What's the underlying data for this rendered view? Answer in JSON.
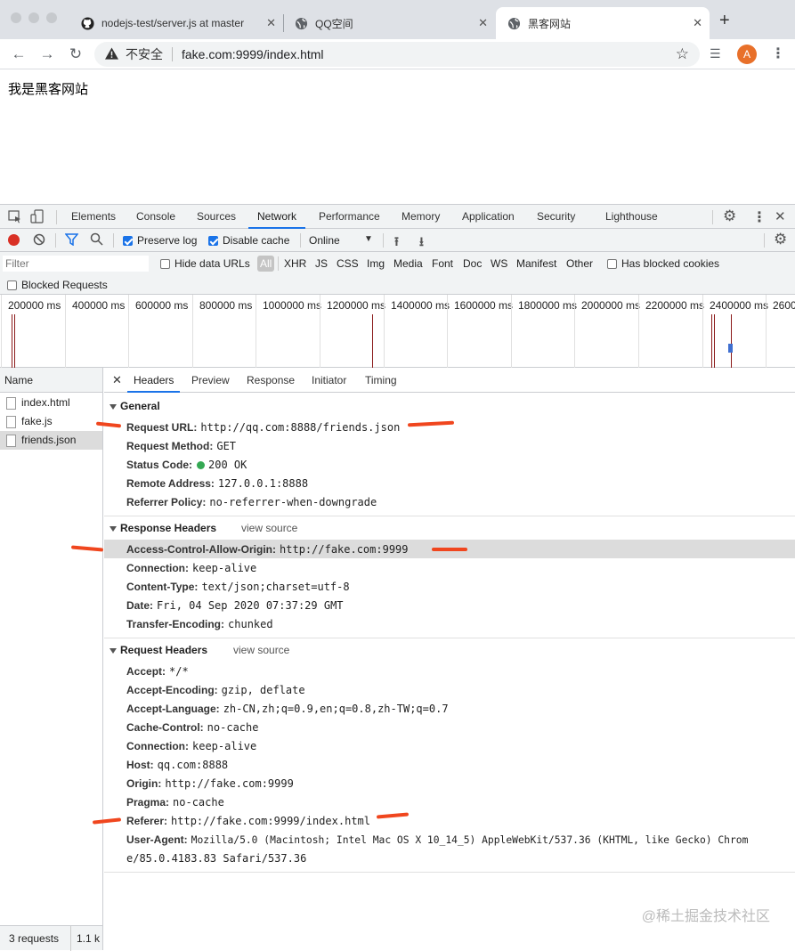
{
  "browser": {
    "tabs": [
      {
        "title": "nodejs-test/server.js at master",
        "icon": "github-icon"
      },
      {
        "title": "QQ空间",
        "icon": "globe-icon"
      },
      {
        "title": "黑客网站",
        "icon": "globe-icon"
      }
    ],
    "new_tab": "+",
    "security_label": "不安全",
    "url": "fake.com:9999/index.html",
    "avatar": "A"
  },
  "page": {
    "heading": "我是黑客网站"
  },
  "devtools": {
    "tabs": [
      "Elements",
      "Console",
      "Sources",
      "Network",
      "Performance",
      "Memory",
      "Application",
      "Security",
      "Lighthouse"
    ],
    "active_tab": "Network",
    "toolbar": {
      "preserve_log": "Preserve log",
      "disable_cache": "Disable cache",
      "throttle": "Online"
    },
    "filter": {
      "placeholder": "Filter",
      "hide_data_urls": "Hide data URLs",
      "types": [
        "All",
        "XHR",
        "JS",
        "CSS",
        "Img",
        "Media",
        "Font",
        "Doc",
        "WS",
        "Manifest",
        "Other"
      ],
      "has_blocked_cookies": "Has blocked cookies",
      "blocked_requests": "Blocked Requests"
    },
    "timeline_ticks": [
      "200000 ms",
      "400000 ms",
      "600000 ms",
      "800000 ms",
      "1000000 ms",
      "1200000 ms",
      "1400000 ms",
      "1600000 ms",
      "1800000 ms",
      "2000000 ms",
      "2200000 ms",
      "2400000 ms",
      "2600"
    ],
    "requests": {
      "header": "Name",
      "items": [
        "index.html",
        "fake.js",
        "friends.json"
      ],
      "footer_count": "3 requests",
      "footer_size": "1.1 k"
    },
    "detail_tabs": [
      "Headers",
      "Preview",
      "Response",
      "Initiator",
      "Timing"
    ],
    "general": {
      "title": "General",
      "rows": [
        {
          "k": "Request URL:",
          "v": "http://qq.com:8888/friends.json"
        },
        {
          "k": "Request Method:",
          "v": "GET"
        },
        {
          "k": "Status Code:",
          "v": "200 OK"
        },
        {
          "k": "Remote Address:",
          "v": "127.0.0.1:8888"
        },
        {
          "k": "Referrer Policy:",
          "v": "no-referrer-when-downgrade"
        }
      ]
    },
    "response_headers": {
      "title": "Response Headers",
      "view_source": "view source",
      "rows": [
        {
          "k": "Access-Control-Allow-Origin:",
          "v": "http://fake.com:9999"
        },
        {
          "k": "Connection:",
          "v": "keep-alive"
        },
        {
          "k": "Content-Type:",
          "v": "text/json;charset=utf-8"
        },
        {
          "k": "Date:",
          "v": "Fri, 04 Sep 2020 07:37:29 GMT"
        },
        {
          "k": "Transfer-Encoding:",
          "v": "chunked"
        }
      ]
    },
    "request_headers": {
      "title": "Request Headers",
      "view_source": "view source",
      "rows": [
        {
          "k": "Accept:",
          "v": "*/*"
        },
        {
          "k": "Accept-Encoding:",
          "v": "gzip, deflate"
        },
        {
          "k": "Accept-Language:",
          "v": "zh-CN,zh;q=0.9,en;q=0.8,zh-TW;q=0.7"
        },
        {
          "k": "Cache-Control:",
          "v": "no-cache"
        },
        {
          "k": "Connection:",
          "v": "keep-alive"
        },
        {
          "k": "Host:",
          "v": "qq.com:8888"
        },
        {
          "k": "Origin:",
          "v": "http://fake.com:9999"
        },
        {
          "k": "Pragma:",
          "v": "no-cache"
        },
        {
          "k": "Referer:",
          "v": "http://fake.com:9999/index.html"
        },
        {
          "k": "User-Agent:",
          "v": "Mozilla/5.0 (Macintosh; Intel Mac OS X 10_14_5) AppleWebKit/537.36 (KHTML, like Gecko) Chrom"
        }
      ],
      "ua_cont": "e/85.0.4183.83 Safari/537.36"
    },
    "colors": {
      "accent": "#1a73e8",
      "record": "#d93025",
      "annotation": "#f0461e",
      "status_ok": "#34a853"
    }
  },
  "watermark": "@稀土掘金技术社区"
}
